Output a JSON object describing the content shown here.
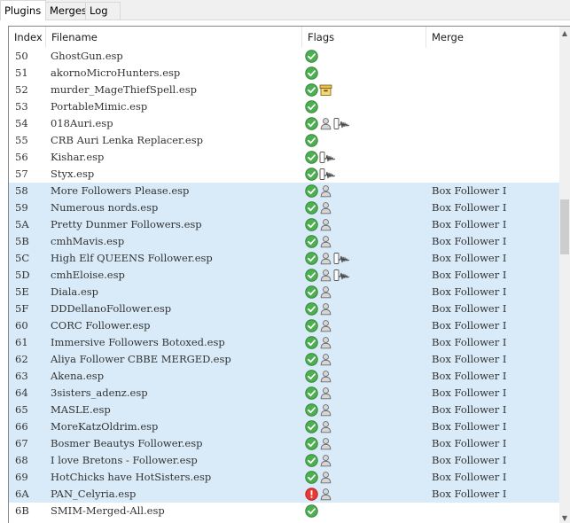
{
  "tabs": [
    {
      "label": "Plugins",
      "active": true
    },
    {
      "label": "Merges",
      "active": false
    },
    {
      "label": "Log",
      "active": false
    }
  ],
  "columns": {
    "index": "Index",
    "filename": "Filename",
    "flags": "Flags",
    "merge": "Merge"
  },
  "colors": {
    "selected_row": "#d9ebf9",
    "ok_icon": "#4caf50",
    "error_icon": "#e53935"
  },
  "rows": [
    {
      "index": "50",
      "filename": "GhostGun.esp",
      "flags": [
        "ok"
      ],
      "merge": "",
      "selected": false
    },
    {
      "index": "51",
      "filename": "akornoMicroHunters.esp",
      "flags": [
        "ok"
      ],
      "merge": "",
      "selected": false
    },
    {
      "index": "52",
      "filename": "murder_MageThiefSpell.esp",
      "flags": [
        "ok",
        "archive"
      ],
      "merge": "",
      "selected": false
    },
    {
      "index": "53",
      "filename": "PortableMimic.esp",
      "flags": [
        "ok"
      ],
      "merge": "",
      "selected": false
    },
    {
      "index": "54",
      "filename": "018Auri.esp",
      "flags": [
        "ok",
        "user",
        "audio"
      ],
      "merge": "",
      "selected": false
    },
    {
      "index": "55",
      "filename": "CRB Auri Lenka Replacer.esp",
      "flags": [
        "ok"
      ],
      "merge": "",
      "selected": false
    },
    {
      "index": "56",
      "filename": "Kishar.esp",
      "flags": [
        "ok",
        "audio"
      ],
      "merge": "",
      "selected": false
    },
    {
      "index": "57",
      "filename": "Styx.esp",
      "flags": [
        "ok",
        "audio"
      ],
      "merge": "",
      "selected": false
    },
    {
      "index": "58",
      "filename": "More Followers Please.esp",
      "flags": [
        "ok",
        "user"
      ],
      "merge": "Box Follower I",
      "selected": true
    },
    {
      "index": "59",
      "filename": "Numerous nords.esp",
      "flags": [
        "ok",
        "user"
      ],
      "merge": "Box Follower I",
      "selected": true
    },
    {
      "index": "5A",
      "filename": "Pretty Dunmer Followers.esp",
      "flags": [
        "ok",
        "user"
      ],
      "merge": "Box Follower I",
      "selected": true
    },
    {
      "index": "5B",
      "filename": "cmhMavis.esp",
      "flags": [
        "ok",
        "user"
      ],
      "merge": "Box Follower I",
      "selected": true
    },
    {
      "index": "5C",
      "filename": "High Elf QUEENS Follower.esp",
      "flags": [
        "ok",
        "user",
        "audio"
      ],
      "merge": "Box Follower I",
      "selected": true
    },
    {
      "index": "5D",
      "filename": "cmhEloise.esp",
      "flags": [
        "ok",
        "user",
        "audio"
      ],
      "merge": "Box Follower I",
      "selected": true
    },
    {
      "index": "5E",
      "filename": "Diala.esp",
      "flags": [
        "ok",
        "user"
      ],
      "merge": "Box Follower I",
      "selected": true
    },
    {
      "index": "5F",
      "filename": "DDDellanoFollower.esp",
      "flags": [
        "ok",
        "user"
      ],
      "merge": "Box Follower I",
      "selected": true
    },
    {
      "index": "60",
      "filename": "CORC Follower.esp",
      "flags": [
        "ok",
        "user"
      ],
      "merge": "Box Follower I",
      "selected": true
    },
    {
      "index": "61",
      "filename": "Immersive Followers Botoxed.esp",
      "flags": [
        "ok",
        "user"
      ],
      "merge": "Box Follower I",
      "selected": true
    },
    {
      "index": "62",
      "filename": "Aliya Follower CBBE MERGED.esp",
      "flags": [
        "ok",
        "user"
      ],
      "merge": "Box Follower I",
      "selected": true
    },
    {
      "index": "63",
      "filename": "Akena.esp",
      "flags": [
        "ok",
        "user"
      ],
      "merge": "Box Follower I",
      "selected": true
    },
    {
      "index": "64",
      "filename": "3sisters_adenz.esp",
      "flags": [
        "ok",
        "user"
      ],
      "merge": "Box Follower I",
      "selected": true
    },
    {
      "index": "65",
      "filename": "MASLE.esp",
      "flags": [
        "ok",
        "user"
      ],
      "merge": "Box Follower I",
      "selected": true
    },
    {
      "index": "66",
      "filename": "MoreKatzOldrim.esp",
      "flags": [
        "ok",
        "user"
      ],
      "merge": "Box Follower I",
      "selected": true
    },
    {
      "index": "67",
      "filename": "Bosmer Beautys Follower.esp",
      "flags": [
        "ok",
        "user"
      ],
      "merge": "Box Follower I",
      "selected": true
    },
    {
      "index": "68",
      "filename": "I love Bretons - Follower.esp",
      "flags": [
        "ok",
        "user"
      ],
      "merge": "Box Follower I",
      "selected": true
    },
    {
      "index": "69",
      "filename": "HotChicks have HotSisters.esp",
      "flags": [
        "ok",
        "user"
      ],
      "merge": "Box Follower I",
      "selected": true
    },
    {
      "index": "6A",
      "filename": "PAN_Celyria.esp",
      "flags": [
        "error",
        "user"
      ],
      "merge": "Box Follower I",
      "selected": true
    },
    {
      "index": "6B",
      "filename": "SMIM-Merged-All.esp",
      "flags": [
        "ok"
      ],
      "merge": "",
      "selected": false
    }
  ]
}
